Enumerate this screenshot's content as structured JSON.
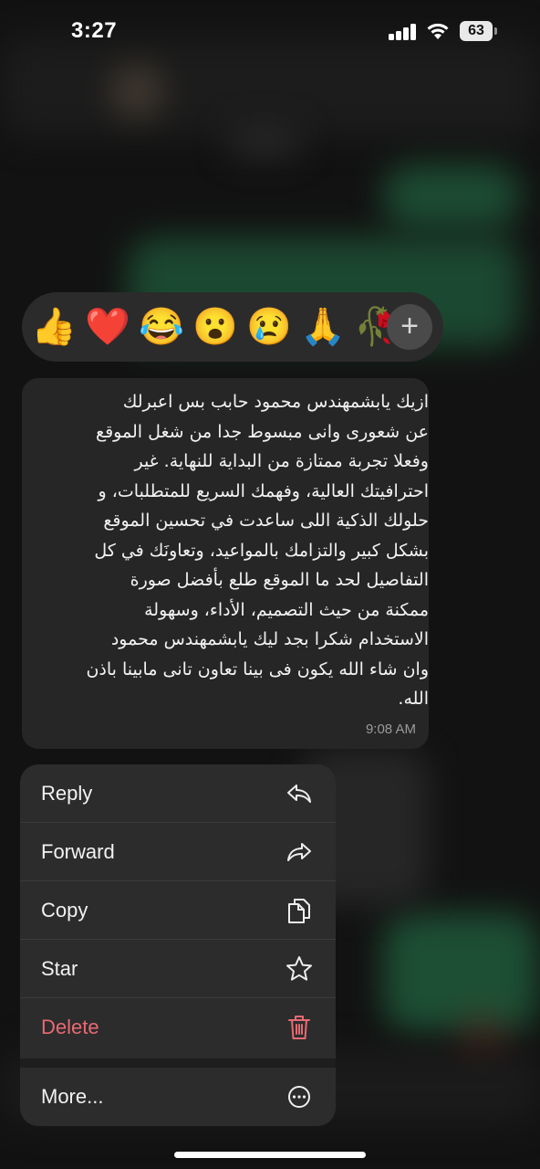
{
  "status_bar": {
    "time": "3:27",
    "battery": "63"
  },
  "reactions": [
    "👍",
    "❤️",
    "😂",
    "😮",
    "😢",
    "🙏",
    "🥀"
  ],
  "message": {
    "text_lines": [
      "ازيك يابشمهندس محمود حابب بس اعبرلك",
      "عن شعورى وانى مبسوط جدا من شغل الموقع",
      "وفعلا تجربة ممتازة من البداية للنهاية. غير",
      "احترافيتك العالية، وفهمك السريع للمتطلبات، و",
      "حلولك الذكية اللى ساعدت في تحسين الموقع",
      "بشكل كبير والتزامك بالمواعيد، وتعاونَك في كل",
      "التفاصيل لحد ما الموقع طلع بأفضل صورة",
      "ممكنة من حيث التصميم، الأداء، وسهولة",
      "الاستخدام شكرا بجد ليك يابشمهندس محمود",
      "وان شاء الله يكون فى بينا تعاون تانى مابينا باذن",
      "الله."
    ],
    "time": "9:08 AM"
  },
  "menu": {
    "reply": "Reply",
    "forward": "Forward",
    "copy": "Copy",
    "star": "Star",
    "delete": "Delete",
    "more": "More..."
  },
  "colors": {
    "danger": "#e86a73",
    "menu_bg": "#2c2c2c",
    "bubble_bg": "#262626"
  },
  "icons": {
    "reply": "reply-arrow-icon",
    "forward": "forward-arrow-icon",
    "copy": "copy-icon",
    "star": "star-icon",
    "delete": "trash-icon",
    "more": "more-ellipsis-icon",
    "add_reaction": "plus-icon"
  }
}
